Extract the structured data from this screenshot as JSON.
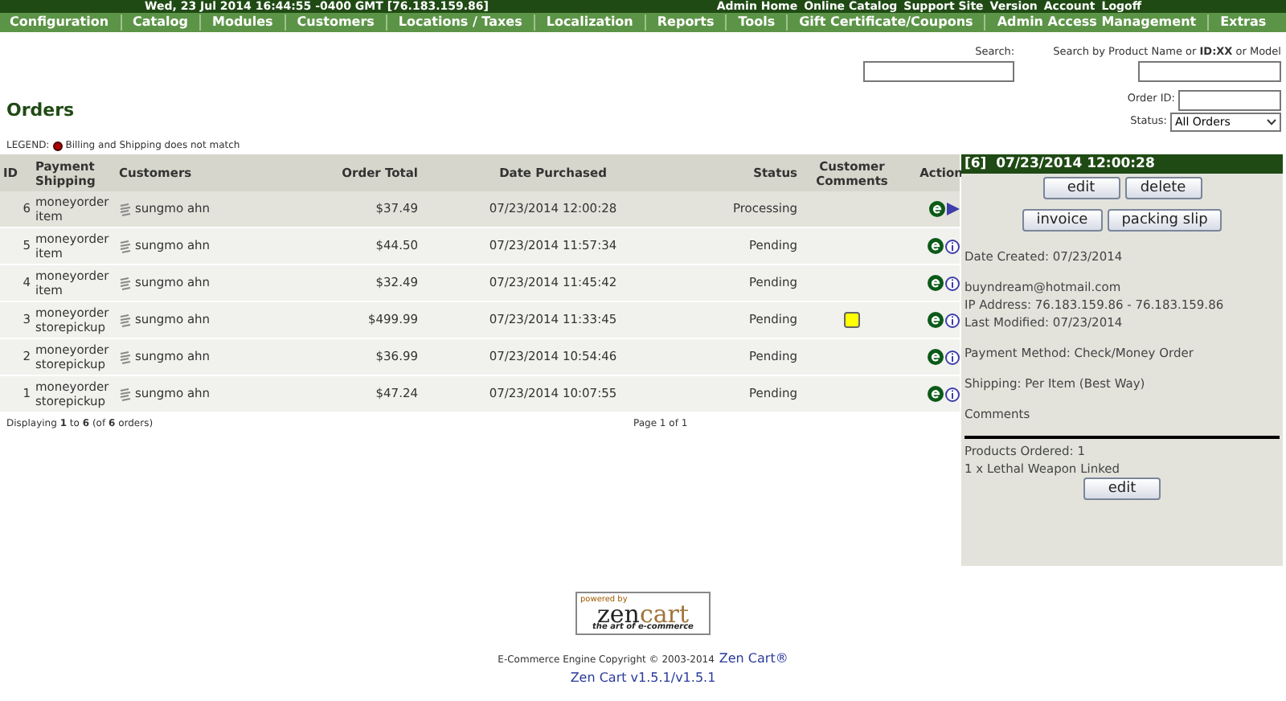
{
  "top_bar": {
    "left": "Wed, 23 Jul 2014 16:44:55 -0400 GMT [76.183.159.86]",
    "links": [
      "Admin Home",
      "Online Catalog",
      "Support Site",
      "Version",
      "Account",
      "Logoff"
    ]
  },
  "menu": [
    "Configuration",
    "Catalog",
    "Modules",
    "Customers",
    "Locations / Taxes",
    "Localization",
    "Reports",
    "Tools",
    "Gift Certificate/Coupons",
    "Admin Access Management",
    "Extras"
  ],
  "title": "Orders",
  "legend": {
    "label": "LEGEND:",
    "text": "Billing and Shipping does not match"
  },
  "search": {
    "label": "Search:",
    "product_label": "Search by Product Name or **ID:XX** or Model",
    "order_id_label": "Order ID:",
    "status_label": "Status:",
    "status_value": "All Orders"
  },
  "table": {
    "columns": [
      "ID",
      "Payment\nShipping",
      "Customers",
      "Order Total",
      "Date Purchased",
      "Status",
      "Customer Comments",
      "Action"
    ],
    "rows": [
      {
        "id": "6",
        "payment": "moneyorder",
        "shipping": "item",
        "customer": "sungmo ahn",
        "total": "$37.49",
        "date": "07/23/2014 12:00:28",
        "status": "Processing",
        "has_comment": false,
        "selected": true
      },
      {
        "id": "5",
        "payment": "moneyorder",
        "shipping": "item",
        "customer": "sungmo ahn",
        "total": "$44.50",
        "date": "07/23/2014 11:57:34",
        "status": "Pending",
        "has_comment": false,
        "selected": false
      },
      {
        "id": "4",
        "payment": "moneyorder",
        "shipping": "item",
        "customer": "sungmo ahn",
        "total": "$32.49",
        "date": "07/23/2014 11:45:42",
        "status": "Pending",
        "has_comment": false,
        "selected": false
      },
      {
        "id": "3",
        "payment": "moneyorder",
        "shipping": "storepickup",
        "customer": "sungmo ahn",
        "total": "$499.99",
        "date": "07/23/2014 11:33:45",
        "status": "Pending",
        "has_comment": true,
        "selected": false
      },
      {
        "id": "2",
        "payment": "moneyorder",
        "shipping": "storepickup",
        "customer": "sungmo ahn",
        "total": "$36.99",
        "date": "07/23/2014 10:54:46",
        "status": "Pending",
        "has_comment": false,
        "selected": false
      },
      {
        "id": "1",
        "payment": "moneyorder",
        "shipping": "storepickup",
        "customer": "sungmo ahn",
        "total": "$47.24",
        "date": "07/23/2014 10:07:55",
        "status": "Pending",
        "has_comment": false,
        "selected": false
      }
    ],
    "displaying": "Displaying **1** to **6** (of **6** orders)",
    "page": "Page 1 of 1"
  },
  "panel": {
    "heading": "[6]  07/23/2014 12:00:28",
    "buttons": [
      "edit",
      "delete",
      "invoice",
      "packing slip"
    ],
    "info": [
      [
        "Date Created: 07/23/2014"
      ],
      [
        "buyndream@hotmail.com",
        "IP Address: 76.183.159.86 - 76.183.159.86",
        "Last Modified: 07/23/2014"
      ],
      [
        "Payment Method: Check/Money Order"
      ],
      [
        "Shipping: Per Item (Best Way)"
      ],
      [
        "Comments"
      ]
    ],
    "products": [
      "Products Ordered: 1",
      "1 x Lethal Weapon Linked"
    ],
    "bottom_button": "edit"
  },
  "footer": {
    "logo_top": "powered by",
    "logo_main": "zen",
    "logo_main2": "cart",
    "logo_tag": "the art of e-commerce",
    "copyright": "E-Commerce Engine Copyright © 2003-2014",
    "link": "Zen Cart®",
    "version": "Zen Cart v1.5.1/v1.5.1"
  }
}
